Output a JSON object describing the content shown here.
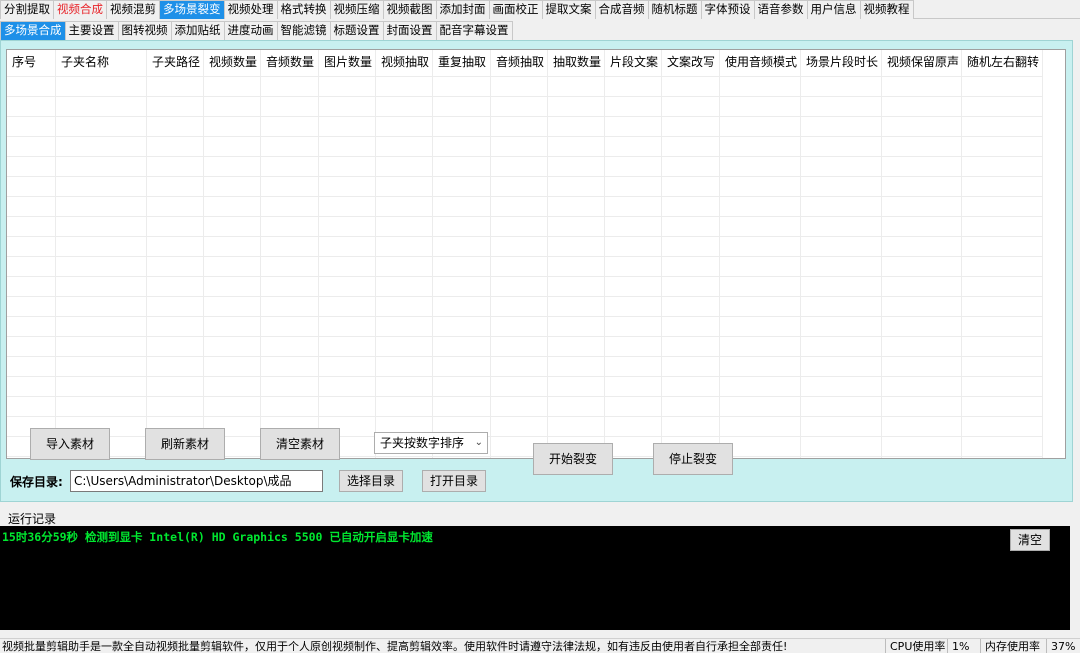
{
  "top_tabs": [
    {
      "label": "分割提取",
      "state": "normal"
    },
    {
      "label": "视频合成",
      "state": "red"
    },
    {
      "label": "视频混剪",
      "state": "normal"
    },
    {
      "label": "多场景裂变",
      "state": "active"
    },
    {
      "label": "视频处理",
      "state": "normal"
    },
    {
      "label": "格式转换",
      "state": "normal"
    },
    {
      "label": "视频压缩",
      "state": "normal"
    },
    {
      "label": "视频截图",
      "state": "normal"
    },
    {
      "label": "添加封面",
      "state": "normal"
    },
    {
      "label": "画面校正",
      "state": "normal"
    },
    {
      "label": "提取文案",
      "state": "normal"
    },
    {
      "label": "合成音频",
      "state": "normal"
    },
    {
      "label": "随机标题",
      "state": "normal"
    },
    {
      "label": "字体预设",
      "state": "normal"
    },
    {
      "label": "语音参数",
      "state": "normal"
    },
    {
      "label": "用户信息",
      "state": "normal"
    },
    {
      "label": "视频教程",
      "state": "normal"
    }
  ],
  "sub_tabs": [
    {
      "label": "多场景合成",
      "state": "active"
    },
    {
      "label": "主要设置",
      "state": "normal"
    },
    {
      "label": "图转视频",
      "state": "normal"
    },
    {
      "label": "添加贴纸",
      "state": "normal"
    },
    {
      "label": "进度动画",
      "state": "normal"
    },
    {
      "label": "智能滤镜",
      "state": "normal"
    },
    {
      "label": "标题设置",
      "state": "normal"
    },
    {
      "label": "封面设置",
      "state": "normal"
    },
    {
      "label": "配音字幕设置",
      "state": "normal"
    }
  ],
  "table": {
    "columns": [
      "序号",
      "子夹名称",
      "子夹路径",
      "视频数量",
      "音频数量",
      "图片数量",
      "视频抽取",
      "重复抽取",
      "音频抽取",
      "抽取数量",
      "片段文案",
      "文案改写",
      "使用音频模式",
      "场景片段时长",
      "视频保留原声",
      "随机左右翻转"
    ],
    "rows": []
  },
  "buttons": {
    "import": "导入素材",
    "refresh": "刷新素材",
    "clear": "清空素材",
    "start": "开始裂变",
    "stop": "停止裂变",
    "choose_dir": "选择目录",
    "open_dir": "打开目录"
  },
  "sort_select": {
    "value": "子夹按数字排序"
  },
  "save_dir": {
    "label": "保存目录:",
    "value": "C:\\Users\\Administrator\\Desktop\\成品"
  },
  "log": {
    "label": "运行记录",
    "line": "15时36分59秒 检测到显卡 Intel(R) HD Graphics 5500 已自动开启显卡加速",
    "clear_button": "清空"
  },
  "status_bar": {
    "notice": "视频批量剪辑助手是一款全自动视频批量剪辑软件，仅用于个人原创视频制作、提高剪辑效率。使用软件时请遵守法律法规，如有违反由使用者自行承担全部责任!",
    "cpu_label": "CPU使用率",
    "cpu_value": "1%",
    "mem_label": "内存使用率",
    "mem_value": "37%"
  },
  "colors": {
    "active_tab": "#1e90e8",
    "red_tab_text": "#e8242a",
    "panel_bg": "#c8f0f0",
    "log_bg": "#000000",
    "log_text": "#00e830"
  }
}
